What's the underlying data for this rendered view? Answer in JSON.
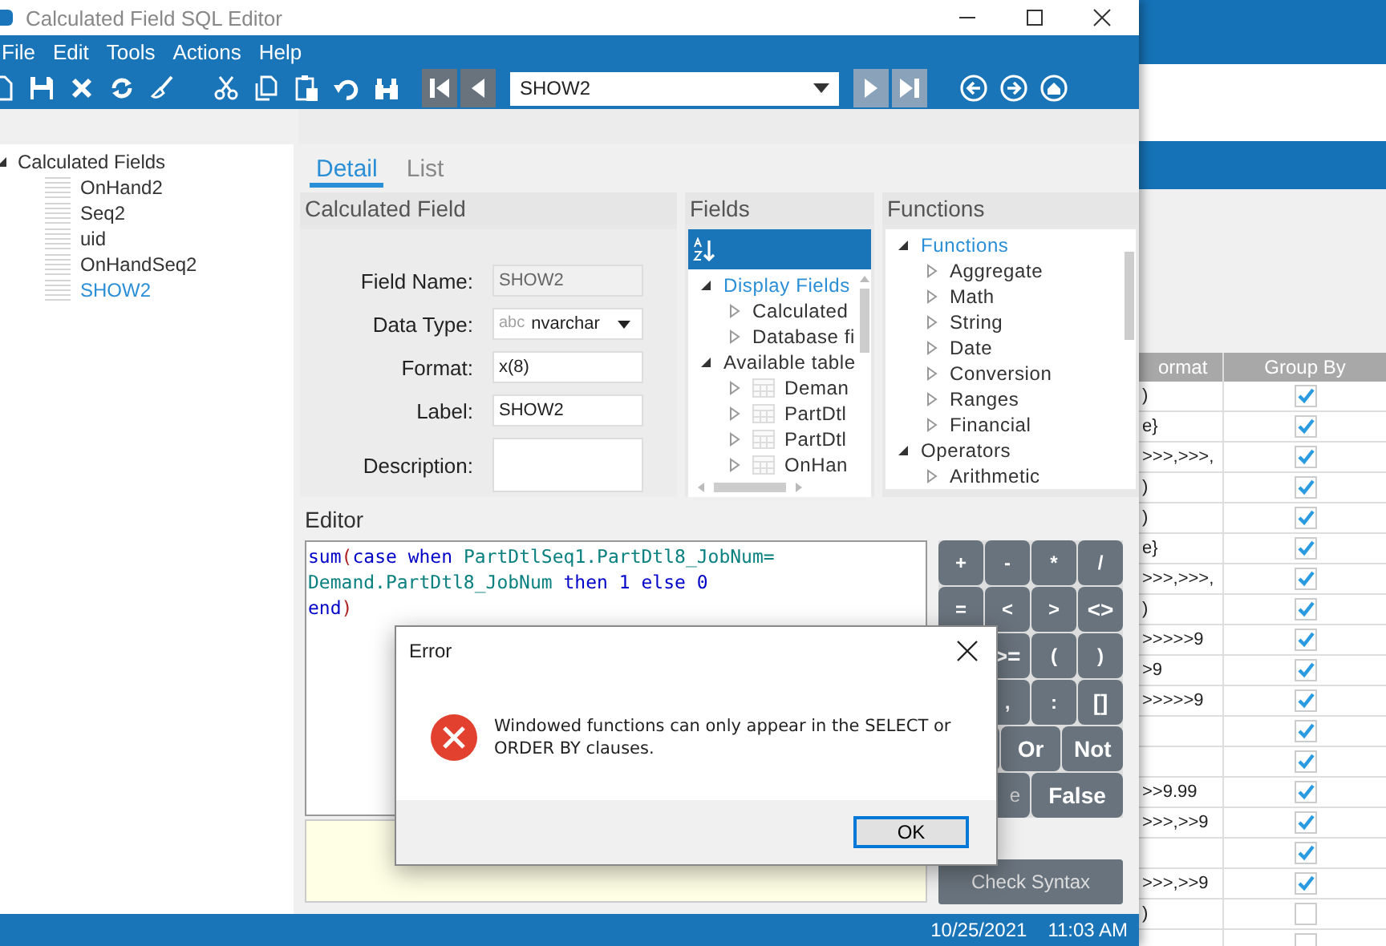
{
  "window": {
    "title": "Calculated Field SQL Editor"
  },
  "menu": [
    "File",
    "Edit",
    "Tools",
    "Actions",
    "Help"
  ],
  "toolbar": {
    "record": "SHOW2",
    "nav": [
      {
        "kind": "first",
        "disabled": false
      },
      {
        "kind": "prev",
        "disabled": false
      },
      {
        "kind": "next",
        "disabled": true
      },
      {
        "kind": "last",
        "disabled": true
      }
    ]
  },
  "tree": {
    "label": "Calculated Fields",
    "expanded": true,
    "children": [
      {
        "label": "OnHand2",
        "selected": false
      },
      {
        "label": "Seq2",
        "selected": false
      },
      {
        "label": "uid",
        "selected": false
      },
      {
        "label": "OnHandSeq2",
        "selected": false
      },
      {
        "label": "SHOW2",
        "selected": true
      }
    ]
  },
  "tabs": [
    {
      "label": "Detail",
      "selected": true
    },
    {
      "label": "List",
      "selected": false
    }
  ],
  "calculated_field": {
    "title": "Calculated Field",
    "rows": [
      {
        "kind": "text",
        "label": "Field Name:",
        "value": "SHOW2",
        "disabled": true
      },
      {
        "kind": "select",
        "label": "Data Type:",
        "prefix": "abc",
        "value": "nvarchar"
      },
      {
        "kind": "text",
        "label": "Format:",
        "value": "x(8)",
        "disabled": false
      },
      {
        "kind": "text",
        "label": "Label:",
        "value": "SHOW2",
        "disabled": false
      },
      {
        "kind": "textarea",
        "label": "Description:"
      }
    ]
  },
  "fields": {
    "title": "Fields",
    "tree": [
      {
        "label": "Display Fields",
        "expanded": true,
        "selected": true,
        "children": [
          {
            "label": "Calculated",
            "kind": "group",
            "expanded": false
          },
          {
            "label": "Database fi",
            "kind": "group",
            "expanded": false
          }
        ]
      },
      {
        "label": "Available table",
        "expanded": true,
        "selected": false,
        "children": [
          {
            "label": "Deman",
            "kind": "table",
            "expanded": false
          },
          {
            "label": "PartDtl",
            "kind": "table",
            "expanded": false
          },
          {
            "label": "PartDtl",
            "kind": "table",
            "expanded": false
          },
          {
            "label": "OnHan",
            "kind": "table",
            "expanded": false
          }
        ]
      }
    ]
  },
  "functions": {
    "title": "Functions",
    "tree": [
      {
        "label": "Functions",
        "expanded": true,
        "selected": true,
        "children": [
          {
            "label": "Aggregate",
            "expanded": false
          },
          {
            "label": "Math",
            "expanded": false
          },
          {
            "label": "String",
            "expanded": false
          },
          {
            "label": "Date",
            "expanded": false
          },
          {
            "label": "Conversion",
            "expanded": false
          },
          {
            "label": "Ranges",
            "expanded": false
          },
          {
            "label": "Financial",
            "expanded": false
          }
        ]
      },
      {
        "label": "Operators",
        "expanded": true,
        "selected": false,
        "children": [
          {
            "label": "Arithmetic",
            "expanded": false
          }
        ]
      }
    ]
  },
  "editor": {
    "title": "Editor",
    "lines": [
      [
        {
          "kind": "keyword",
          "text": "sum"
        },
        {
          "kind": "paren",
          "text": "("
        },
        {
          "kind": "keyword",
          "text": "case when "
        },
        {
          "kind": "ident",
          "text": "PartDtlSeq1.PartDtl8_JobNum="
        }
      ],
      [
        {
          "kind": "ident",
          "text": "Demand.PartDtl8_JobNum"
        },
        {
          "kind": "keyword",
          "text": " then 1 else 0"
        }
      ],
      [
        {
          "kind": "keyword",
          "text": "end"
        },
        {
          "kind": "paren",
          "text": ")"
        }
      ]
    ]
  },
  "calculator": {
    "rows": [
      {
        "keys": [
          {
            "kind": "key",
            "label": "+"
          },
          {
            "kind": "key",
            "label": "-"
          },
          {
            "kind": "key",
            "label": "*"
          },
          {
            "kind": "key",
            "label": "/"
          }
        ]
      },
      {
        "keys": [
          {
            "kind": "key",
            "label": "="
          },
          {
            "kind": "key",
            "label": "<"
          },
          {
            "kind": "key",
            "label": ">"
          },
          {
            "kind": "key",
            "label": "<>"
          }
        ]
      },
      {
        "keys": [
          {
            "kind": "covered"
          },
          {
            "kind": "key",
            "label": ">="
          },
          {
            "kind": "key",
            "label": "("
          },
          {
            "kind": "key",
            "label": ")"
          }
        ]
      },
      {
        "keys": [
          {
            "kind": "covered"
          },
          {
            "kind": "key",
            "label": ","
          },
          {
            "kind": "key",
            "label": ":"
          },
          {
            "kind": "key",
            "label": "[]"
          }
        ]
      },
      {
        "keys": [
          {
            "kind": "covered"
          },
          {
            "kind": "key",
            "label": "Or"
          },
          {
            "kind": "key",
            "label": "Not"
          }
        ]
      },
      {
        "keys": [
          {
            "kind": "cut",
            "label": "e"
          },
          {
            "kind": "key",
            "label": "False"
          }
        ]
      }
    ]
  },
  "check_syntax": "Check Syntax",
  "status_bar": {
    "date": "10/25/2021",
    "time": "11:03 AM"
  },
  "dialog": {
    "title": "Error",
    "message": "Windowed functions can only appear in the SELECT or ORDER BY clauses.",
    "button": "OK"
  },
  "background_table": {
    "columns": [
      "ormat",
      "Group By"
    ],
    "rows": [
      {
        "format": ")",
        "group_by": true
      },
      {
        "format": "e}",
        "group_by": true
      },
      {
        "format": ">>>,>>>,",
        "group_by": true
      },
      {
        "format": ")",
        "group_by": true
      },
      {
        "format": ")",
        "group_by": true
      },
      {
        "format": "e}",
        "group_by": true
      },
      {
        "format": ">>>,>>>,",
        "group_by": true
      },
      {
        "format": ")",
        "group_by": true
      },
      {
        "format": ">>>>>9",
        "group_by": true
      },
      {
        "format": ">9",
        "group_by": true
      },
      {
        "format": ">>>>>9",
        "group_by": true
      },
      {
        "group_by": true
      },
      {
        "group_by": true
      },
      {
        "format": ">>9.99",
        "group_by": true
      },
      {
        "format": ">>>,>>9",
        "group_by": true
      },
      {
        "group_by": true
      },
      {
        "format": ">>>,>>9",
        "group_by": true
      },
      {
        "format": ")",
        "group_by": false
      },
      {
        "group_by": false
      }
    ]
  }
}
